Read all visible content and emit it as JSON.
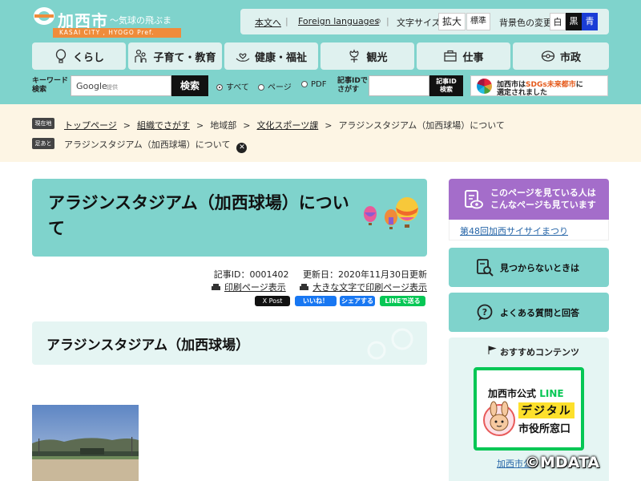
{
  "header": {
    "logo_name": "加西市",
    "logo_tagline": "〜気球の飛ぶまち〜",
    "logo_bar": "KASAI CITY , HYOGO Pref.",
    "util": {
      "skip_link": "本文へ",
      "foreign_link": "Foreign languages",
      "foreign_icon": "⊘",
      "font_size_label": "文字サイズ",
      "font_size_large": "拡大",
      "font_size_normal": "標準",
      "bg_label": "背景色の変更",
      "bg_white": "白",
      "bg_black": "黒",
      "bg_blue": "青"
    },
    "nav": [
      {
        "label": "くらし",
        "icon": "balloon-icon"
      },
      {
        "label": "子育て・教育",
        "icon": "family-icon"
      },
      {
        "label": "健康・福祉",
        "icon": "hands-heart-icon"
      },
      {
        "label": "観光",
        "icon": "flower-icon"
      },
      {
        "label": "仕事",
        "icon": "briefcase-icon"
      },
      {
        "label": "市政",
        "icon": "city-hall-icon"
      }
    ],
    "search": {
      "keyword_label_1": "キーワード",
      "keyword_label_2": "検索",
      "google_label": "Google",
      "google_sub": "提供",
      "button": "検索",
      "radio_all": "すべて",
      "radio_page": "ページ",
      "radio_pdf": "PDF",
      "id_label_1": "記事IDで",
      "id_label_2": "さがす",
      "id_button_1": "記事ID",
      "id_button_2": "検索"
    },
    "sdgs": {
      "text_1_pre": "加西市は",
      "text_1_hl": "SDGs未来都市",
      "text_1_post": "に",
      "text_2": "選定されました"
    }
  },
  "breadcrumb": {
    "current_tag": "現在地",
    "items": [
      "トップページ",
      "組織でさがす",
      "地域部",
      "文化スポーツ課",
      "アラジンスタジアム（加西球場）について"
    ],
    "history_tag": "足あと",
    "history_item": "アラジンスタジアム（加西球場）について"
  },
  "article": {
    "title": "アラジンスタジアム（加西球場）について",
    "article_id": "記事ID：0001402",
    "updated": "更新日：2020年11月30日更新",
    "print_label": "印刷ページ表示",
    "large_print_label": "大きな文字で印刷ページ表示",
    "sns": {
      "x": "X Post",
      "fb_like": "いいね！",
      "fb_share": "シェアする",
      "line": "LINEで送る"
    },
    "heading": "アラジンスタジアム（加西球場）"
  },
  "sidebar": {
    "related_title_1": "このページを見ている人は",
    "related_title_2": "こんなページも見ています",
    "related_link": "第48回加西サイサイまつり",
    "not_found": "見つからないときは",
    "faq": "よくある質問と回答",
    "recommend_title": "おすすめコンテンツ",
    "line_card": {
      "l1_pre": "加西市公式",
      "l1_hl": "LINE",
      "l2": "デジタル",
      "l3": "市役所窓口"
    },
    "recommend_link": "加西市公"
  },
  "watermark": "©MDATA",
  "colors": {
    "teal": "#7fd3cc",
    "teal_light": "#e5f5f3",
    "purple": "#a46dca",
    "line_green": "#06c755",
    "cream": "#fdf5e4"
  }
}
